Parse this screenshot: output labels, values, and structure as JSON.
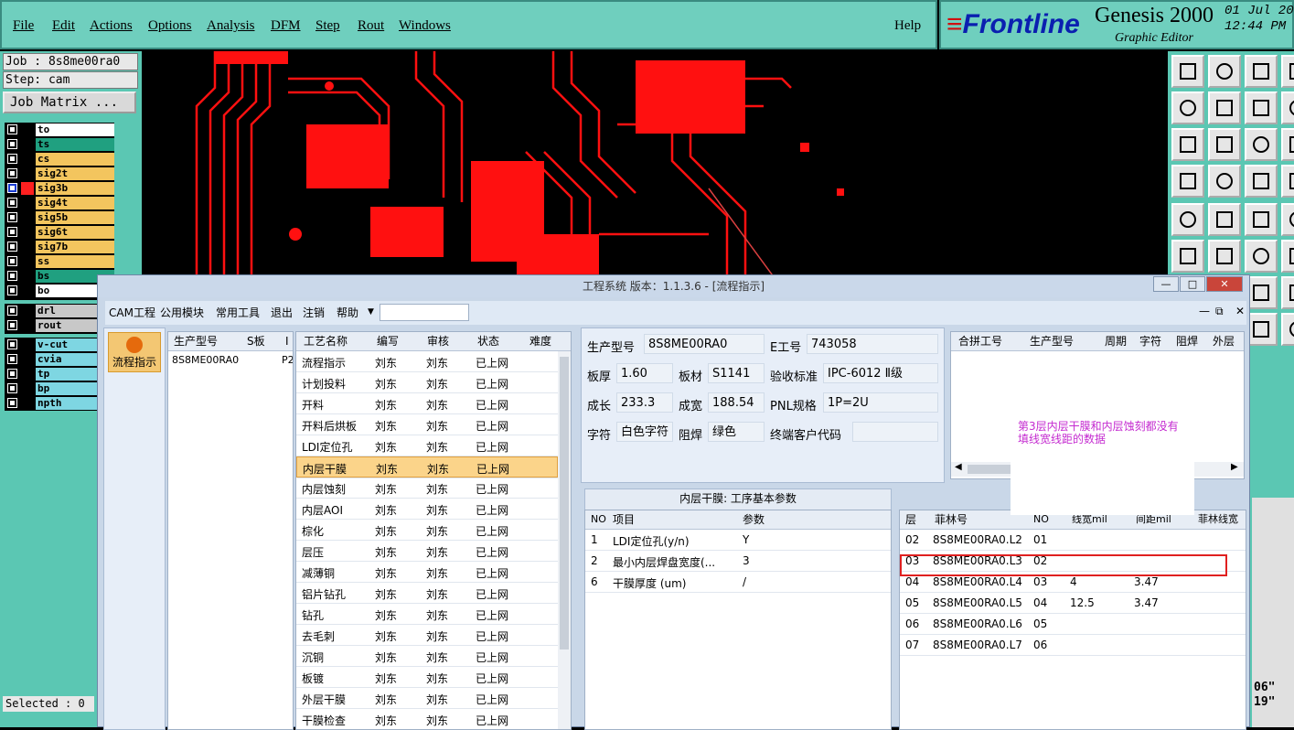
{
  "menu": [
    "File",
    "Edit",
    "Actions",
    "Options",
    "Analysis",
    "DFM",
    "Step",
    "Rout",
    "Windows"
  ],
  "help": "Help",
  "logo": {
    "brand": "Frontline",
    "product": "Genesis 2000",
    "subtitle": "Graphic Editor",
    "date": "01 Jul 20",
    "time": "12:44 PM"
  },
  "job": {
    "job_label": "Job : 8s8me00ra0",
    "step_label": "Step: cam",
    "matrix_button": "Job Matrix ..."
  },
  "layers_group1": [
    {
      "name": "to",
      "color": "#ffffff"
    },
    {
      "name": "ts",
      "color": "#20a080"
    },
    {
      "name": "cs",
      "color": "#f3c55e"
    },
    {
      "name": "sig2t",
      "color": "#f3c55e"
    },
    {
      "name": "sig3b",
      "color": "#f3c55e"
    },
    {
      "name": "sig4t",
      "color": "#f3c55e"
    },
    {
      "name": "sig5b",
      "color": "#f3c55e"
    },
    {
      "name": "sig6t",
      "color": "#f3c55e"
    },
    {
      "name": "sig7b",
      "color": "#f3c55e"
    },
    {
      "name": "ss",
      "color": "#f3c55e"
    },
    {
      "name": "bs",
      "color": "#20a080"
    },
    {
      "name": "bo",
      "color": "#ffffff"
    }
  ],
  "layers_group2": [
    {
      "name": "drl",
      "color": "#c8c8c8"
    },
    {
      "name": "rout",
      "color": "#c8c8c8"
    }
  ],
  "layers_group3": [
    {
      "name": "v-cut",
      "color": "#7ed6e2"
    },
    {
      "name": "cvia",
      "color": "#7ed6e2"
    },
    {
      "name": "tp",
      "color": "#7ed6e2"
    },
    {
      "name": "bp",
      "color": "#7ed6e2"
    },
    {
      "name": "npth",
      "color": "#7ed6e2"
    }
  ],
  "selected": "Selected : 0",
  "right_edge_text": [
    "06\"",
    "19\""
  ],
  "dialog": {
    "title": "工程系统   版本：1.1.3.6 - [流程指示]",
    "menu": [
      "CAM工程",
      "公用模块",
      "常用工具",
      "退出",
      "注销",
      "帮助"
    ],
    "nav_button": "流程指示",
    "products_headers": [
      "生产型号",
      "S板",
      "I"
    ],
    "product_row": [
      "8S8ME00RA0",
      "P2"
    ],
    "process_headers": [
      "工艺名称",
      "编写",
      "审核",
      "状态",
      "难度"
    ],
    "process_rows": [
      [
        "流程指示",
        "刘东",
        "刘东",
        "已上网"
      ],
      [
        "计划投料",
        "刘东",
        "刘东",
        "已上网"
      ],
      [
        "开料",
        "刘东",
        "刘东",
        "已上网"
      ],
      [
        "开料后烘板",
        "刘东",
        "刘东",
        "已上网"
      ],
      [
        "LDI定位孔",
        "刘东",
        "刘东",
        "已上网"
      ],
      [
        "内层干膜",
        "刘东",
        "刘东",
        "已上网"
      ],
      [
        "内层蚀刻",
        "刘东",
        "刘东",
        "已上网"
      ],
      [
        "内层AOI",
        "刘东",
        "刘东",
        "已上网"
      ],
      [
        "棕化",
        "刘东",
        "刘东",
        "已上网"
      ],
      [
        "层压",
        "刘东",
        "刘东",
        "已上网"
      ],
      [
        "减薄铜",
        "刘东",
        "刘东",
        "已上网"
      ],
      [
        "铝片钻孔",
        "刘东",
        "刘东",
        "已上网"
      ],
      [
        "钻孔",
        "刘东",
        "刘东",
        "已上网"
      ],
      [
        "去毛刺",
        "刘东",
        "刘东",
        "已上网"
      ],
      [
        "沉铜",
        "刘东",
        "刘东",
        "已上网"
      ],
      [
        "板镀",
        "刘东",
        "刘东",
        "已上网"
      ],
      [
        "外层干膜",
        "刘东",
        "刘东",
        "已上网"
      ],
      [
        "干膜检查",
        "刘东",
        "刘东",
        "已上网"
      ]
    ],
    "info": {
      "prod_model_label": "生产型号",
      "prod_model": "8S8ME00RA0",
      "e_no_label": "E工号",
      "e_no": "743058",
      "thick_label": "板厚",
      "thick": "1.60",
      "mat_label": "板材",
      "mat": "S1141",
      "std_label": "验收标准",
      "std": "IPC-6012 Ⅱ级",
      "len_label": "成长",
      "len": "233.3",
      "wid_label": "成宽",
      "wid": "188.54",
      "pnl_label": "PNL规格",
      "pnl": "1P=2U",
      "char_label": "字符",
      "char": "白色字符",
      "mask_label": "阻焊",
      "mask": "绿色",
      "cust_label": "终端客户代码",
      "cust": ""
    },
    "combo_headers": [
      "合拼工号",
      "生产型号",
      "周期",
      "字符",
      "阻焊",
      "外层"
    ],
    "params_title": "内层干膜: 工序基本参数",
    "params_headers": [
      "NO",
      "项目",
      "参数"
    ],
    "params_rows": [
      [
        "1",
        "LDI定位孔(y/n)",
        "Y"
      ],
      [
        "2",
        "最小内层焊盘宽度(...",
        "3"
      ],
      [
        "6",
        "干膜厚度 (um)",
        "/"
      ]
    ],
    "film_headers": [
      "层",
      "菲林号",
      "NO",
      "线宽mil",
      "间距mil",
      "菲林线宽"
    ],
    "film_rows": [
      [
        "02",
        "8S8ME00RA0.L2",
        "01",
        "",
        ""
      ],
      [
        "03",
        "8S8ME00RA0.L3",
        "02",
        "",
        ""
      ],
      [
        "04",
        "8S8ME00RA0.L4",
        "03",
        "4",
        "3.47"
      ],
      [
        "05",
        "8S8ME00RA0.L5",
        "04",
        "12.5",
        "3.47"
      ],
      [
        "06",
        "8S8ME00RA0.L6",
        "05",
        "",
        ""
      ],
      [
        "07",
        "8S8ME00RA0.L7",
        "06",
        "",
        ""
      ]
    ],
    "annotation": "第3层内层干膜和内层蚀刻都没有填线宽线距的数据"
  }
}
